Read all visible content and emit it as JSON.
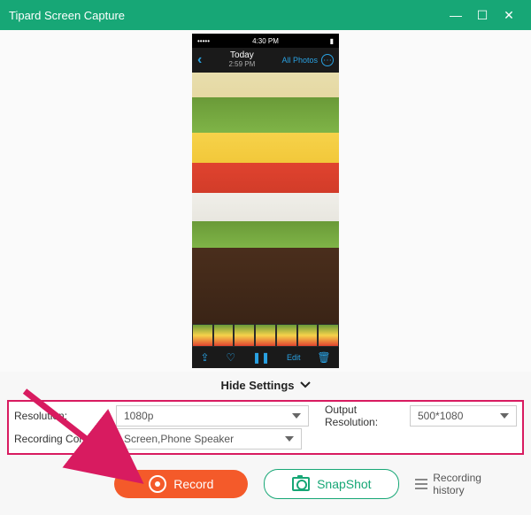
{
  "window": {
    "title": "Tipard Screen Capture"
  },
  "phone": {
    "carrier": "•••••",
    "time": "4:30 PM",
    "date_label": "Today",
    "date_time": "2:59 PM",
    "all_photos": "All Photos",
    "tools": {
      "share": "⇪",
      "like": "♡",
      "pause": "❚❚",
      "edit": "Edit",
      "trash": "🗑"
    }
  },
  "hide_label": "Hide Settings",
  "settings": {
    "resolution_label": "Resolution:",
    "resolution_value": "1080p",
    "output_label": "Output Resolution:",
    "output_value": "500*1080",
    "content_label": "Recording Content:",
    "content_value": "Screen,Phone Speaker"
  },
  "buttons": {
    "record": "Record",
    "snapshot": "SnapShot",
    "history": "Recording history"
  }
}
